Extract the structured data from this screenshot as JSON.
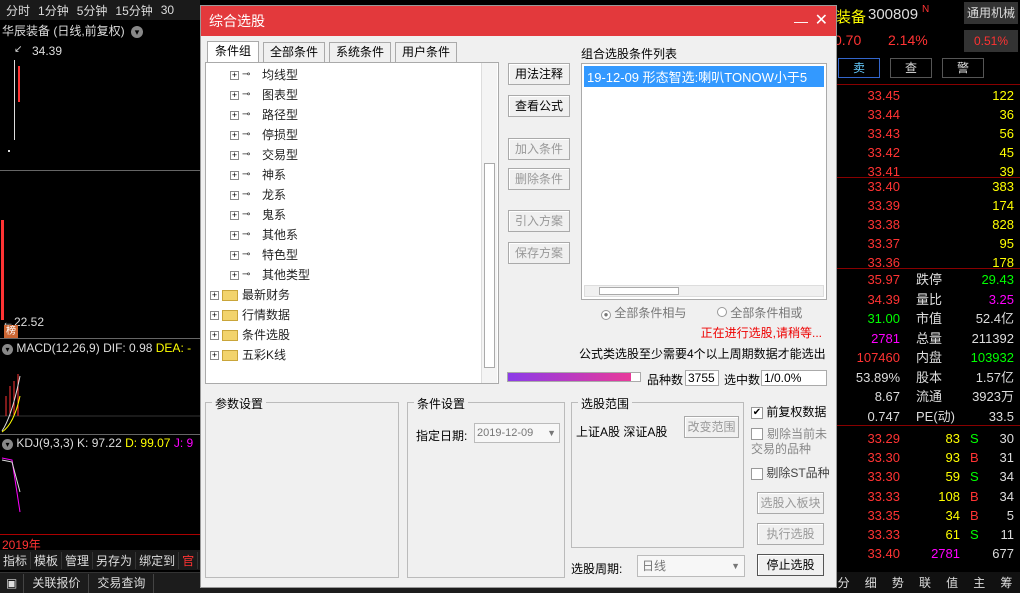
{
  "left": {
    "periods": [
      "分时",
      "1分钟",
      "5分钟",
      "15分钟",
      "30"
    ],
    "stock_title": "华辰装备 (日线,前复权)",
    "high_label": "34.39",
    "low_label": "22.52",
    "badge": "榜",
    "macd": {
      "label": "MACD(12,26,9)",
      "dif": "DIF: 0.98",
      "dea": "DEA: -"
    },
    "kdj": {
      "label": "KDJ(9,3,3)",
      "k": "K: 97.22",
      "d": "D: 99.07",
      "j": "J: 9"
    },
    "year": "2019年",
    "tabs": [
      "指标",
      "模板",
      "管理",
      "另存为",
      "绑定到",
      "官"
    ]
  },
  "status": {
    "items": [
      "关联报价",
      "交易查询"
    ]
  },
  "dialog": {
    "title": "综合选股",
    "tabs": [
      "条件组",
      "全部条件",
      "系统条件",
      "用户条件"
    ],
    "tree_items": [
      "均线型",
      "图表型",
      "路径型",
      "停损型",
      "交易型",
      "神系",
      "龙系",
      "鬼系",
      "其他系",
      "特色型",
      "其他类型"
    ],
    "tree_folders": [
      "最新财务",
      "行情数据",
      "条件选股",
      "五彩K线"
    ],
    "buttons": {
      "usage": "用法注释",
      "view_formula": "查看公式",
      "add_cond": "加入条件",
      "del_cond": "删除条件",
      "import_plan": "引入方案",
      "save_plan": "保存方案",
      "change_range": "改变范围",
      "to_block": "选股入板块",
      "run": "执行选股",
      "stop": "停止选股"
    },
    "list_title": "组合选股条件列表",
    "list_items": [
      "19-12-09 形态智选:喇叭TONOW小于5"
    ],
    "radio_and": "全部条件相与",
    "radio_or": "全部条件相或",
    "running": "正在进行选股,请稍等...",
    "note": "公式类选股至少需要4个以上周期数据才能选出",
    "count_label": "品种数",
    "count_value": "3755",
    "selected_label": "选中数",
    "selected_value": "1/0.0%",
    "progress": 0.93,
    "param_label": "参数设置",
    "cond_label": "条件设置",
    "date_label": "指定日期:",
    "date_value": "2019-12-09",
    "range_label": "选股范围",
    "range_value": "上证A股 深证A股",
    "opt_prefq": "前复权数据",
    "opt_exclude_susp": "剔除当前未交易的品种",
    "opt_exclude_st": "剔除ST品种",
    "period_label": "选股周期:",
    "period_value": "日线"
  },
  "right": {
    "name": "装备",
    "code": "300809",
    "flag": "N",
    "sector": "通用机械",
    "sector_pct": "0.51%",
    "change": "0.70",
    "change_pct": "2.14%",
    "btn_sell": "卖",
    "btn_check": "查",
    "btn_alert": "警",
    "asks": [
      [
        "33.45",
        "122"
      ],
      [
        "33.44",
        "36"
      ],
      [
        "33.43",
        "56"
      ],
      [
        "33.42",
        "45"
      ],
      [
        "33.41",
        "39"
      ]
    ],
    "bids": [
      [
        "33.40",
        "383"
      ],
      [
        "33.39",
        "174"
      ],
      [
        "33.38",
        "828"
      ],
      [
        "33.37",
        "95"
      ],
      [
        "33.36",
        "178"
      ]
    ],
    "stats": [
      [
        "35.97",
        "跌停",
        "29.43"
      ],
      [
        "34.39",
        "量比",
        "3.25"
      ],
      [
        "31.00",
        "市值",
        "52.4亿"
      ],
      [
        "2781",
        "总量",
        "211392"
      ],
      [
        "107460",
        "内盘",
        "103932"
      ],
      [
        "53.89%",
        "股本",
        "1.57亿"
      ],
      [
        "8.67",
        "流通",
        "3923万"
      ],
      [
        "0.747",
        "PE(动)",
        "33.5"
      ]
    ],
    "ticks": [
      [
        "33.29",
        "83",
        "S",
        "30"
      ],
      [
        "33.30",
        "93",
        "B",
        "31"
      ],
      [
        "33.30",
        "59",
        "S",
        "34"
      ],
      [
        "33.33",
        "108",
        "B",
        "34"
      ],
      [
        "33.35",
        "34",
        "B",
        "5"
      ],
      [
        "33.33",
        "61",
        "S",
        "11"
      ],
      [
        "33.40",
        "2781",
        "",
        "677"
      ]
    ],
    "bottom_tabs": [
      "分",
      "细",
      "势",
      "联",
      "值",
      "主",
      "筹"
    ]
  }
}
